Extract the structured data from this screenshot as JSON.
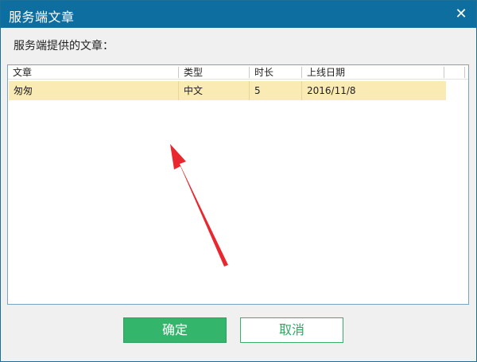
{
  "window": {
    "title": "服务端文章",
    "close_glyph": "✕"
  },
  "prompt": "服务端提供的文章：",
  "table": {
    "columns": [
      "文章",
      "类型",
      "时长",
      "上线日期"
    ],
    "rows": [
      [
        "匆匆",
        "中文",
        "5",
        "2016/11/8"
      ]
    ],
    "selected_row_color": "#faebb4"
  },
  "buttons": {
    "ok_label": "确定",
    "cancel_label": "取消"
  },
  "colors": {
    "titlebar": "#0f6ea0",
    "ok_button": "#33b56c",
    "annotation_arrow": "#e8282e"
  },
  "annotation": {
    "icon": "red-arrow-icon"
  }
}
